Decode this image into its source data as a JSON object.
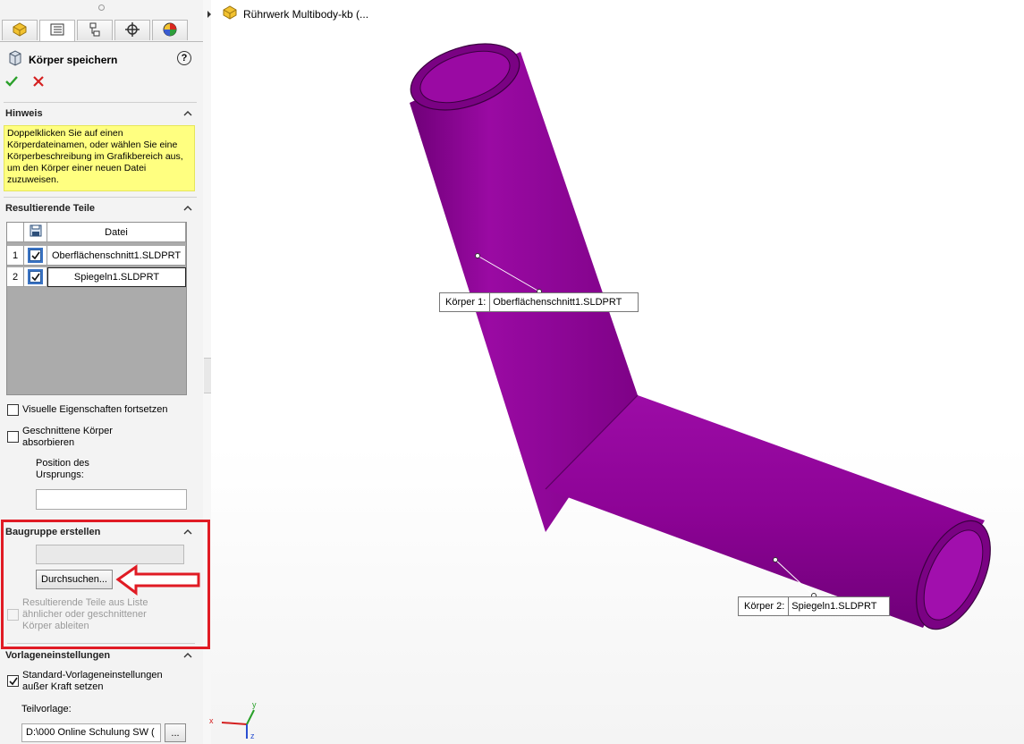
{
  "tabs": [
    "feature-manager",
    "property-manager",
    "configuration-manager",
    "dimxpert-manager",
    "display-manager"
  ],
  "property_manager": {
    "title": "Körper speichern",
    "help": "?",
    "ok": "✔",
    "cancel": "✖"
  },
  "hint_section": {
    "title": "Hinweis",
    "text": "Doppelklicken Sie auf einen Körperdateinamen, oder wählen Sie eine Körperbeschreibung im Grafikbereich aus, um den Körper einer neuen Datei zuzuweisen."
  },
  "resulting_parts": {
    "title": "Resultierende Teile",
    "column_file": "Datei",
    "rows": [
      {
        "num": "1",
        "checked": true,
        "file": "Oberflächenschnitt1.SLDPRT"
      },
      {
        "num": "2",
        "checked": true,
        "file": "Spiegeln1.SLDPRT"
      }
    ],
    "options": {
      "visual_properties": "Visuelle Eigenschaften fortsetzen",
      "absorb_cut_bodies": "Geschnittene Körper absorbieren",
      "origin_position": "Position des Ursprungs:",
      "origin_value": ""
    }
  },
  "create_assembly": {
    "title": "Baugruppe erstellen",
    "path_value": "",
    "browse_label": "Durchsuchen...",
    "derive_label": "Resultierende Teile aus Liste ähnlicher oder geschnittener Körper ableiten"
  },
  "template_settings": {
    "title": "Vorlageneinstellungen",
    "override_label": "Standard-Vorlageneinstellungen außer Kraft setzen",
    "override_checked": true,
    "part_template_label": "Teilvorlage:",
    "part_template_value": "D:\\000 Online Schulung SW (",
    "browse_small": "..."
  },
  "graphics": {
    "tree_title": "Rührwerk Multibody-kb  (...",
    "body_color": "#8e0396",
    "callout1": {
      "prefix": "Körper  1:",
      "name": "Oberflächenschnitt1.SLDPRT"
    },
    "callout2": {
      "prefix": "Körper  2:",
      "name": "Spiegeln1.SLDPRT"
    }
  },
  "triad": {
    "x": "x",
    "y": "y",
    "z": "z"
  }
}
